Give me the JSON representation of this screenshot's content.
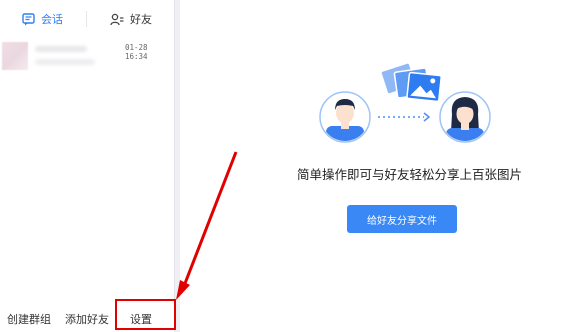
{
  "tabs": {
    "chat_label": "会话",
    "friends_label": "好友"
  },
  "conversation": {
    "time": "01-28 16:34"
  },
  "bottom_bar": {
    "create_group": "创建群组",
    "add_friend": "添加好友",
    "settings": "设置"
  },
  "main": {
    "promo_text": "简单操作即可与好友轻松分享上百张图片",
    "share_button": "给好友分享文件"
  },
  "colors": {
    "accent": "#2d7ef6",
    "button": "#3a87f6",
    "annotation": "#e00000"
  }
}
